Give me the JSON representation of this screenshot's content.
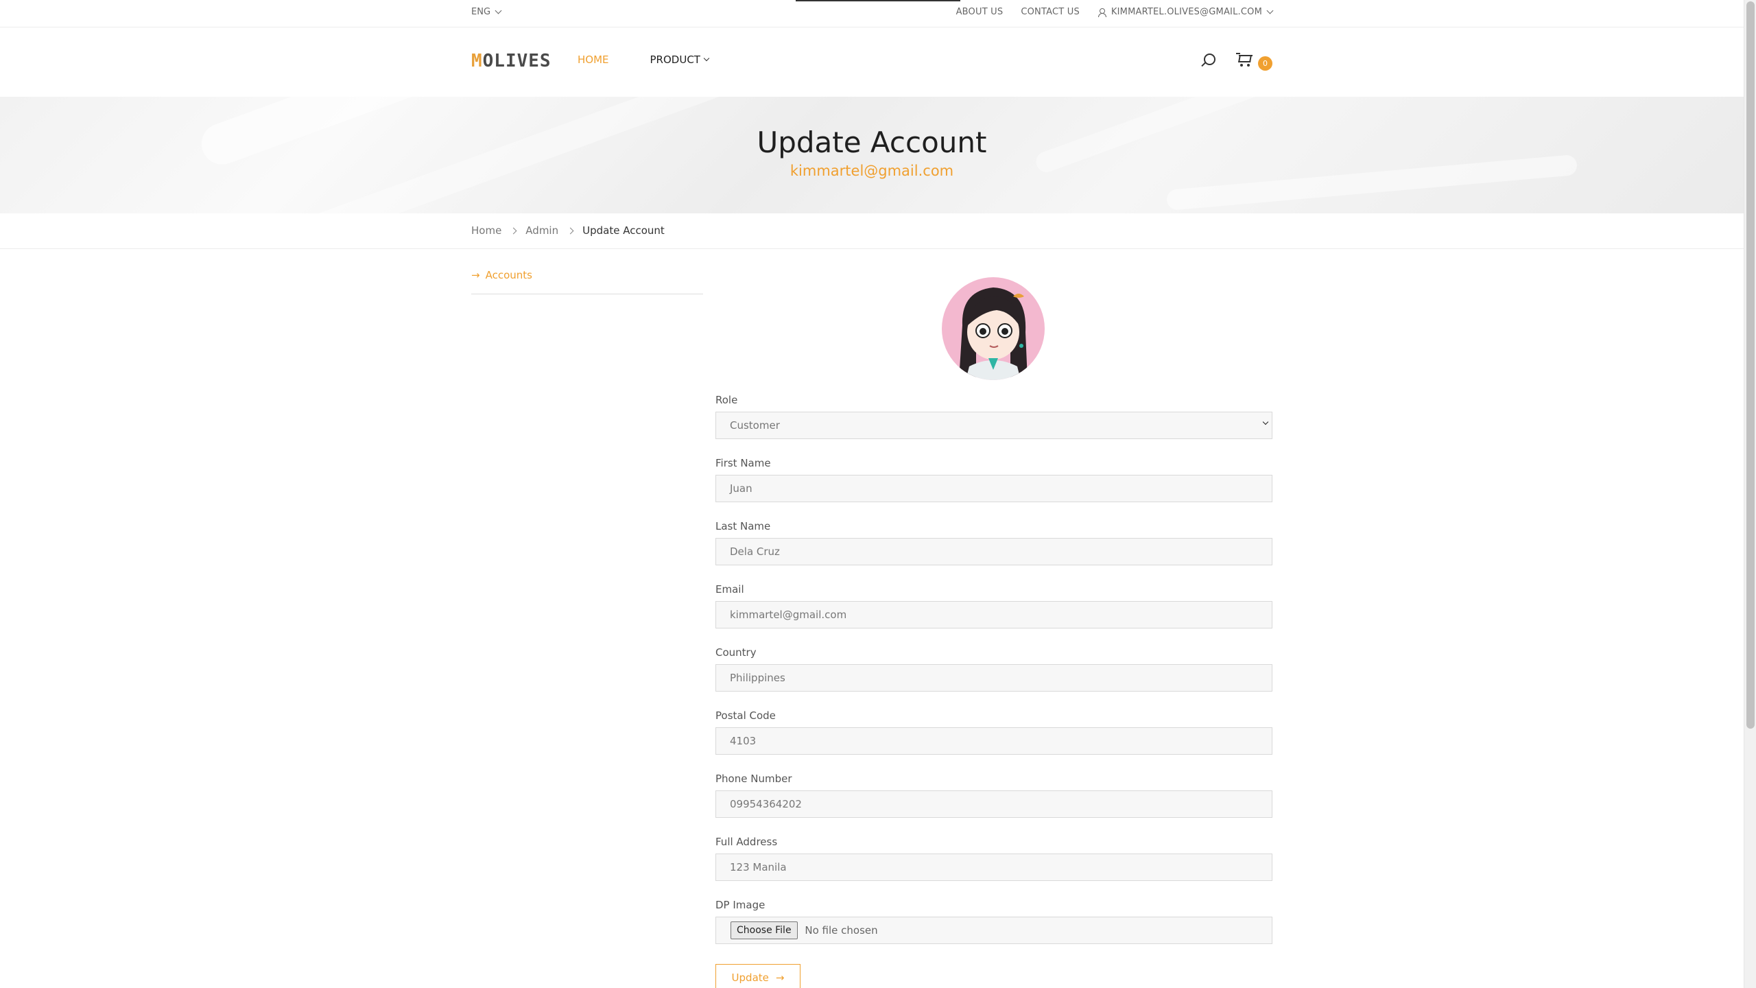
{
  "topbar": {
    "language": "ENG",
    "about": "ABOUT US",
    "contact": "CONTACT US",
    "user_email": "KIMMARTEL.OLIVES@GMAIL.COM"
  },
  "header": {
    "logo": "OLIVES",
    "nav": {
      "home": "HOME",
      "product": "PRODUCT"
    },
    "cart_count": "0"
  },
  "hero": {
    "title": "Update Account",
    "subtitle": "kimmartel@gmail.com"
  },
  "breadcrumb": [
    "Home",
    "Admin",
    "Update Account"
  ],
  "sidebar": {
    "accounts_link": "Accounts",
    "arrow": "→"
  },
  "form": {
    "role": {
      "label": "Role",
      "value": "Customer"
    },
    "first_name": {
      "label": "First Name",
      "value": "Juan"
    },
    "last_name": {
      "label": "Last Name",
      "value": "Dela Cruz"
    },
    "email": {
      "label": "Email",
      "value": "kimmartel@gmail.com"
    },
    "country": {
      "label": "Country",
      "value": "Philippines"
    },
    "postal_code": {
      "label": "Postal Code",
      "value": "4103"
    },
    "phone": {
      "label": "Phone Number",
      "value": "09954364202"
    },
    "address": {
      "label": "Full Address",
      "value": "123 Manila"
    },
    "dp_image": {
      "label": "DP Image",
      "button": "Choose File",
      "status": "No file chosen"
    },
    "submit": "Update",
    "submit_arrow": "→"
  },
  "colors": {
    "accent": "#f0a030",
    "text": "#222222",
    "input_bg": "#f7f7f7"
  }
}
